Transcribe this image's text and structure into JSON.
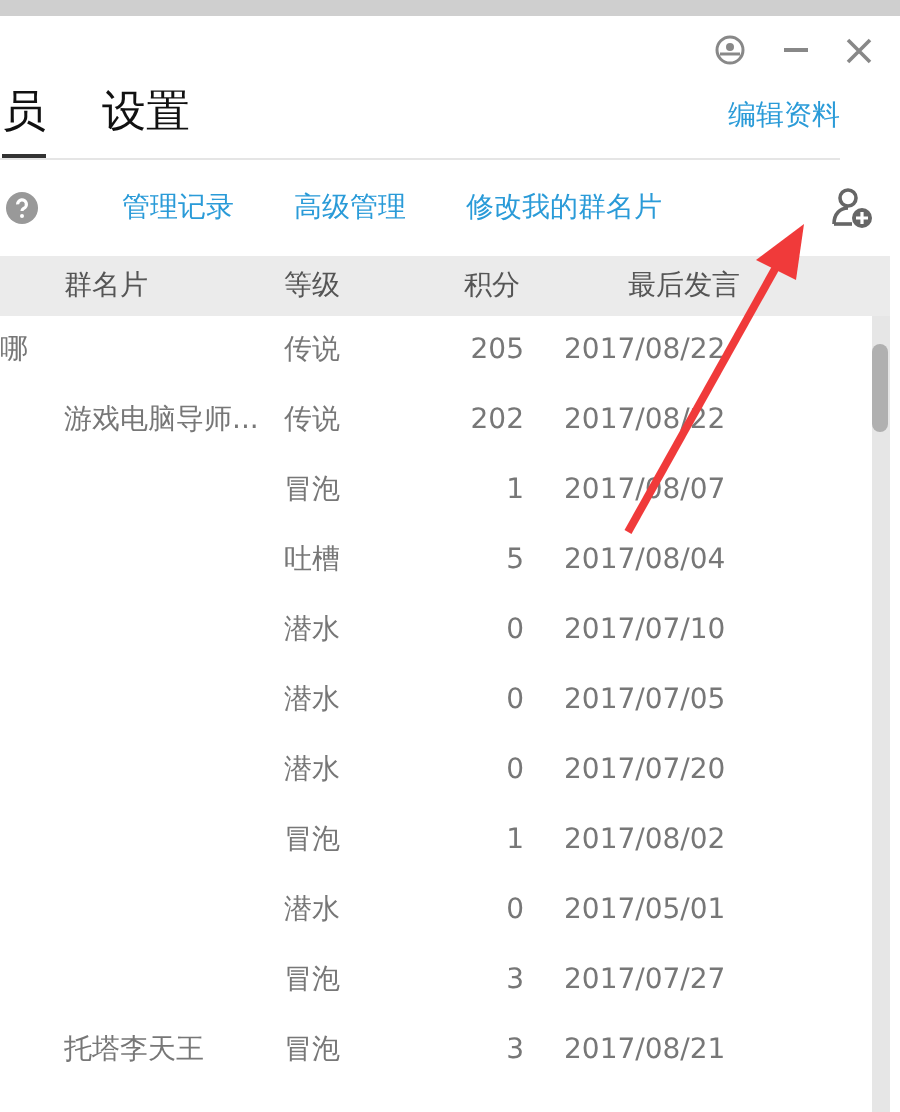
{
  "tabs": [
    {
      "label": "员",
      "selected": true
    },
    {
      "label": "设置",
      "selected": false
    }
  ],
  "edit_link": "编辑资料",
  "toolbar_links": [
    "管理记录",
    "高级管理",
    "修改我的群名片"
  ],
  "table": {
    "columns": [
      "群名片",
      "等级",
      "积分",
      "最后发言"
    ],
    "rows": [
      {
        "name": "哪",
        "card": "",
        "level": "传说",
        "points": "205",
        "last_post": "2017/08/22"
      },
      {
        "name": "",
        "card": "游戏电脑导师...",
        "level": "传说",
        "points": "202",
        "last_post": "2017/08/22"
      },
      {
        "name": "",
        "card": "",
        "level": "冒泡",
        "points": "1",
        "last_post": "2017/08/07"
      },
      {
        "name": "",
        "card": "",
        "level": "吐槽",
        "points": "5",
        "last_post": "2017/08/04"
      },
      {
        "name": "",
        "card": "",
        "level": "潜水",
        "points": "0",
        "last_post": "2017/07/10"
      },
      {
        "name": "",
        "card": "",
        "level": "潜水",
        "points": "0",
        "last_post": "2017/07/05"
      },
      {
        "name": "",
        "card": "",
        "level": "潜水",
        "points": "0",
        "last_post": "2017/07/20"
      },
      {
        "name": "",
        "card": "",
        "level": "冒泡",
        "points": "1",
        "last_post": "2017/08/02"
      },
      {
        "name": "",
        "card": "",
        "level": "潜水",
        "points": "0",
        "last_post": "2017/05/01"
      },
      {
        "name": "",
        "card": "",
        "level": "冒泡",
        "points": "3",
        "last_post": "2017/07/27"
      },
      {
        "name": "",
        "card": "托塔李天王",
        "level": "冒泡",
        "points": "3",
        "last_post": "2017/08/21"
      }
    ]
  }
}
